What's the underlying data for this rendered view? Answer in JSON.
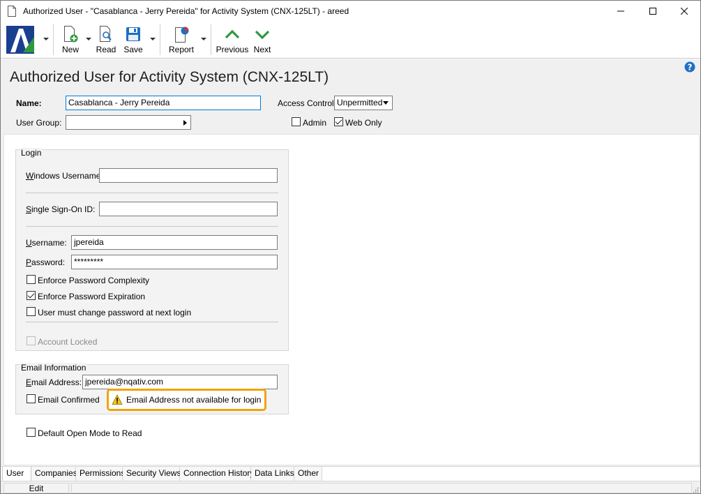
{
  "window": {
    "title": "Authorized User - \"Casablanca - Jerry Pereida\" for Activity System (CNX-125LT) - areed"
  },
  "toolbar": {
    "new_label": "New",
    "read_label": "Read",
    "save_label": "Save",
    "report_label": "Report",
    "previous_label": "Previous",
    "next_label": "Next"
  },
  "header": {
    "page_title": "Authorized User for Activity System (CNX-125LT)",
    "name_label": "Name:",
    "name_value": "Casablanca - Jerry Pereida",
    "user_group_label": "User Group:",
    "user_group_value": "",
    "access_control_label": "Access Control:",
    "access_control_value": "Unpermitted",
    "admin_label": "Admin",
    "admin_checked": false,
    "web_only_label": "Web Only",
    "web_only_checked": true
  },
  "login": {
    "group_title": "Login",
    "windows_username_label": "Windows Username:",
    "windows_username_value": "",
    "sso_label": "Single Sign-On ID:",
    "sso_value": "",
    "username_label": "Username:",
    "username_value": "jpereida",
    "password_label": "Password:",
    "password_value": "*********",
    "enforce_complexity_label": "Enforce Password Complexity",
    "enforce_complexity_checked": false,
    "enforce_expiration_label": "Enforce Password Expiration",
    "enforce_expiration_checked": true,
    "must_change_label": "User must change password at next login",
    "must_change_checked": false,
    "account_locked_label": "Account Locked",
    "account_locked_checked": false
  },
  "email": {
    "group_title": "Email Information",
    "address_label": "Email Address:",
    "address_value": "jpereida@nqativ.com",
    "confirmed_label": "Email Confirmed",
    "confirmed_checked": false,
    "warning_text": "Email Address not available for login"
  },
  "options": {
    "default_open_read_label": "Default Open Mode to Read",
    "default_open_read_checked": false
  },
  "tabs": [
    {
      "label": "User",
      "active": true
    },
    {
      "label": "Companies",
      "active": false
    },
    {
      "label": "Permissions",
      "active": false
    },
    {
      "label": "Security Views",
      "active": false
    },
    {
      "label": "Connection History",
      "active": false
    },
    {
      "label": "Data Links",
      "active": false
    },
    {
      "label": "Other",
      "active": false
    }
  ],
  "status": {
    "mode": "Edit"
  },
  "colors": {
    "accent": "#0078d7",
    "warning_border": "#f0a30a",
    "nav_arrow_green": "#2e9a3e",
    "help_blue": "#1f6fc5"
  }
}
